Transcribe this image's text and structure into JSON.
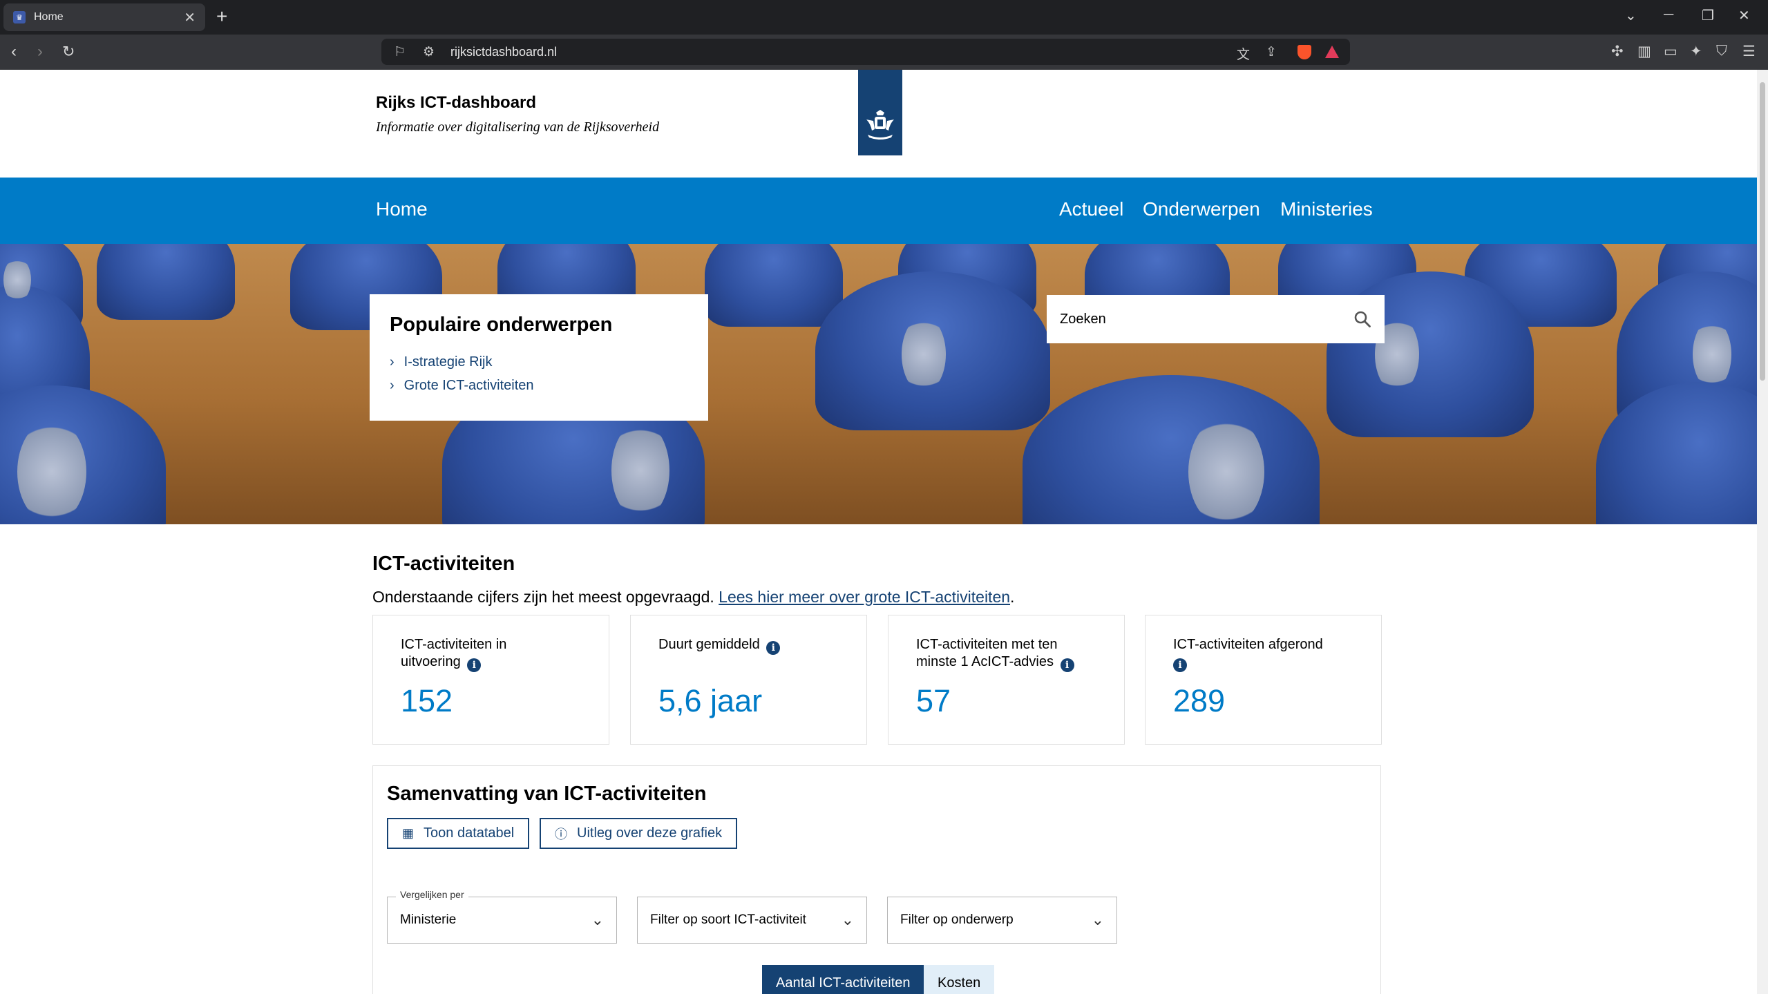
{
  "browser": {
    "tab_title": "Home",
    "url": "rijksictdashboard.nl"
  },
  "header": {
    "title": "Rijks ICT-dashboard",
    "subtitle": "Informatie over digitalisering van de Rijksoverheid"
  },
  "nav": {
    "home": "Home",
    "items": [
      "Actueel",
      "Onderwerpen",
      "Ministeries"
    ]
  },
  "popular": {
    "heading": "Populaire onderwerpen",
    "links": [
      "I-strategie Rijk",
      "Grote ICT-activiteiten"
    ]
  },
  "search": {
    "placeholder": "Zoeken"
  },
  "activities": {
    "title": "ICT-activiteiten",
    "intro_text": "Onderstaande cijfers zijn het meest opgevraagd.",
    "intro_link": "Lees hier meer over grote ICT-activiteiten",
    "intro_end": ".",
    "stats": [
      {
        "label_1": "ICT-activiteiten in",
        "label_2": "uitvoering",
        "value": "152"
      },
      {
        "label_1": "Duurt gemiddeld",
        "label_2": "",
        "value": "5,6 jaar"
      },
      {
        "label_1": "ICT-activiteiten met ten",
        "label_2": "minste 1 AcICT-advies",
        "value": "57"
      },
      {
        "label_1": "ICT-activiteiten afgerond",
        "label_2": "",
        "value": "289"
      }
    ]
  },
  "summary": {
    "title": "Samenvatting van ICT-activiteiten",
    "btn_table": "Toon datatabel",
    "btn_explain": "Uitleg over deze grafiek",
    "compare_label": "Vergelijken per",
    "compare_value": "Ministerie",
    "filter_type": "Filter op soort ICT-activiteit",
    "filter_topic": "Filter op onderwerp",
    "toggle_count": "Aantal ICT-activiteiten",
    "toggle_cost": "Kosten"
  },
  "colors": {
    "nav_blue": "#007bc7",
    "dark_blue": "#154273",
    "stat_value": "#007bc7"
  }
}
